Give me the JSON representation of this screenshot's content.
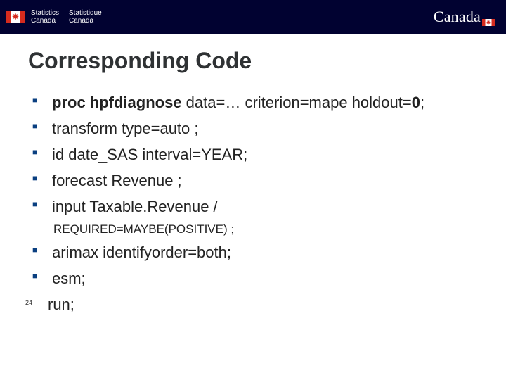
{
  "header": {
    "statcan_en_line1": "Statistics",
    "statcan_en_line2": "Canada",
    "statcan_fr_line1": "Statistique",
    "statcan_fr_line2": "Canada",
    "wordmark": "Canada"
  },
  "title": "Corresponding Code",
  "bullets": {
    "b1_part1": "proc hpfdiagnose",
    "b1_part2": " data=… criterion=mape holdout=",
    "b1_zero": "0",
    "b1_part3": ";",
    "b2": "transform type=auto ;",
    "b3": "id date_SAS interval=YEAR;",
    "b4": "forecast Revenue ;",
    "b5": "input Taxable.Revenue /",
    "b5_sub": "REQUIRED=MAYBE(POSITIVE) ;",
    "b6": "arimax identifyorder=both;",
    "b7": "esm;",
    "b8": "run;"
  },
  "page_num": "24"
}
